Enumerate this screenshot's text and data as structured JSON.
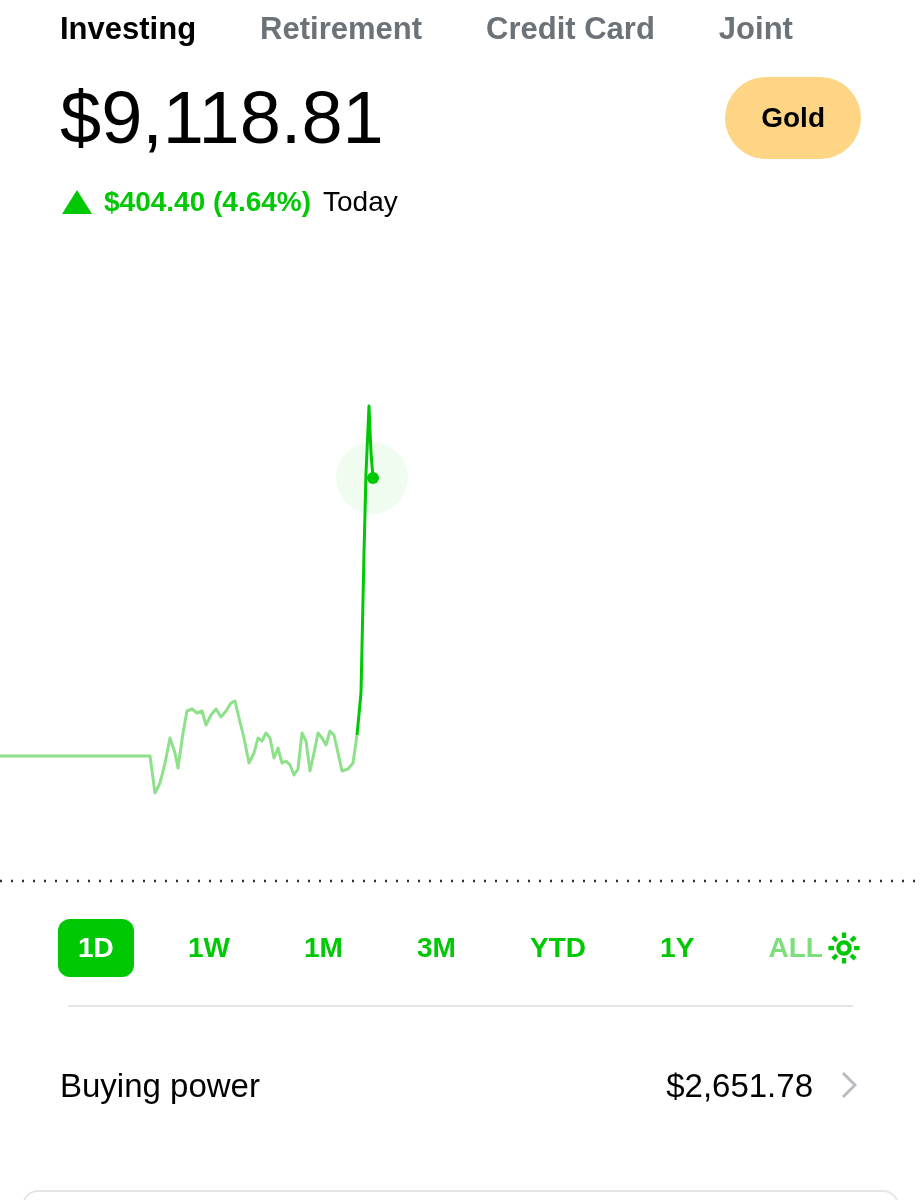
{
  "tabs": [
    {
      "label": "Investing",
      "selected": true
    },
    {
      "label": "Retirement",
      "selected": false
    },
    {
      "label": "Credit Card",
      "selected": false
    },
    {
      "label": "Joint",
      "selected": false
    }
  ],
  "balance": "$9,118.81",
  "badge": "Gold",
  "change": {
    "positive": true,
    "amount": "$404.40 (4.64%)",
    "period": "Today"
  },
  "ranges": [
    {
      "label": "1D",
      "selected": true
    },
    {
      "label": "1W",
      "selected": false
    },
    {
      "label": "1M",
      "selected": false
    },
    {
      "label": "3M",
      "selected": false
    },
    {
      "label": "YTD",
      "selected": false
    },
    {
      "label": "1Y",
      "selected": false
    },
    {
      "label": "ALL",
      "selected": false
    }
  ],
  "buying_power": {
    "label": "Buying power",
    "value": "$2,651.78"
  }
}
